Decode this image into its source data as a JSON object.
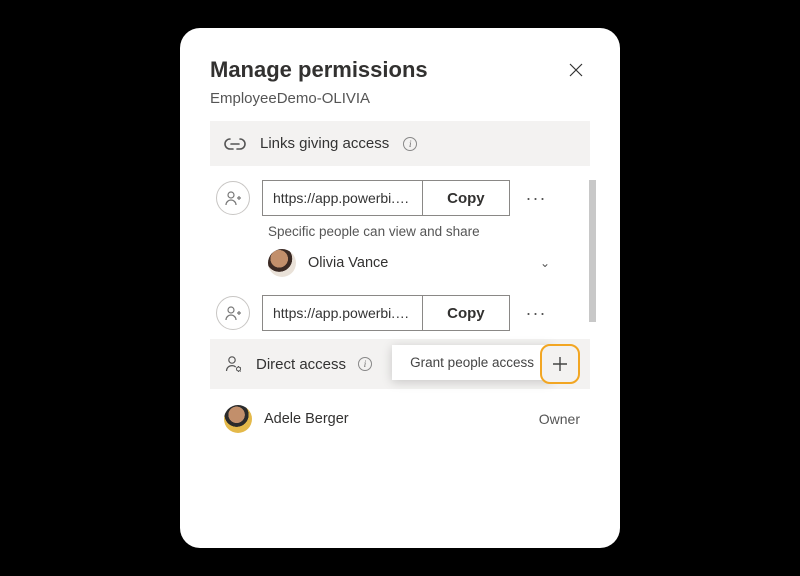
{
  "header": {
    "title": "Manage permissions",
    "subtitle": "EmployeeDemo-OLIVIA"
  },
  "links_section": {
    "label": "Links giving access",
    "items": [
      {
        "url": "https://app.powerbi.c…",
        "copy_label": "Copy",
        "description": "Specific people can view and share",
        "people": [
          {
            "name": "Olivia Vance"
          }
        ]
      },
      {
        "url": "https://app.powerbi.c…",
        "copy_label": "Copy"
      }
    ]
  },
  "direct_section": {
    "label": "Direct access",
    "tooltip": "Grant people access",
    "people": [
      {
        "name": "Adele Berger",
        "role": "Owner"
      }
    ]
  }
}
